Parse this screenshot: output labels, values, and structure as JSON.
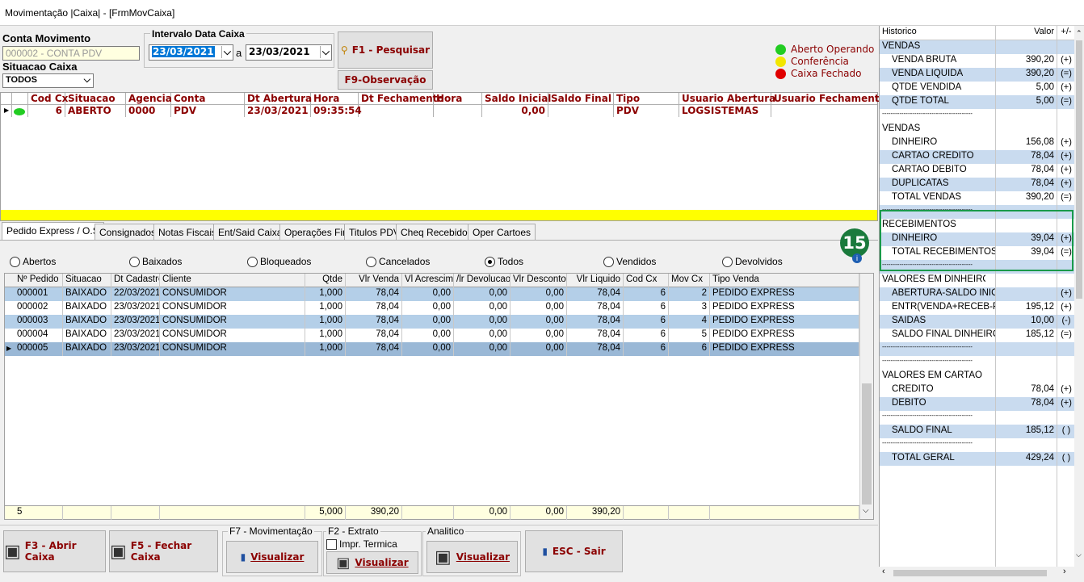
{
  "window": {
    "title": "Movimentação |Caixa| - [FrmMovCaixa]"
  },
  "filters": {
    "conta_label": "Conta Movimento",
    "conta_value": "000002 - CONTA PDV",
    "situacao_label": "Situacao Caixa",
    "situacao_value": "TODOS",
    "intervalo_label": "Intervalo Data Caixa",
    "date_from": "23/03/2021",
    "date_sep": "a",
    "date_to": "23/03/2021",
    "pesquisar": "F1 - Pesquisar",
    "observacao": "F9-Observação"
  },
  "legend": {
    "aberto": "Aberto Operando",
    "conferencia": "Conferência",
    "fechado": "Caixa Fechado",
    "colors": {
      "aberto": "#22cc22",
      "conferencia": "#f2e600",
      "fechado": "#e00000"
    }
  },
  "caixa_grid": {
    "headers": [
      "Cod Cx",
      "Situacao",
      "Agencia",
      "Conta",
      "Dt Abertura",
      "Hora",
      "Dt Fechamento",
      "Hora",
      "Saldo Inicial",
      "Saldo Final",
      "Tipo",
      "Usuario Abertura",
      "Usuario Fechamento"
    ],
    "row": [
      "6",
      "ABERTO",
      "0000",
      "PDV",
      "23/03/2021",
      "09:35:54",
      "",
      "",
      "0,00",
      "",
      "PDV",
      "LOGSISTEMAS",
      ""
    ]
  },
  "tabs": [
    "Pedido Express / O.S",
    "Consignados",
    "Notas Fiscais",
    "Ent/Said Caixa",
    "Operações Fin",
    "Titulos PDV",
    "Cheq Recebidos",
    "Oper Cartoes"
  ],
  "radios": {
    "options": [
      "Abertos",
      "Baixados",
      "Bloqueados",
      "Cancelados",
      "Todos",
      "Vendidos",
      "Devolvidos"
    ],
    "selected": "Todos"
  },
  "badge": "15",
  "pedidos": {
    "headers": [
      "Nº Pedido",
      "Situacao",
      "Dt Cadastro",
      "Cliente",
      "Qtde",
      "Vlr Venda",
      "Vl Acrescim",
      "/lr Devolucao",
      "Vlr Desconto",
      "Vlr Liquido",
      "Cod Cx",
      "Mov Cx",
      "Tipo Venda"
    ],
    "rows": [
      [
        "000001",
        "BAIXADO",
        "22/03/2021",
        "CONSUMIDOR",
        "1,000",
        "78,04",
        "0,00",
        "0,00",
        "0,00",
        "78,04",
        "6",
        "2",
        "PEDIDO EXPRESS"
      ],
      [
        "000002",
        "BAIXADO",
        "23/03/2021",
        "CONSUMIDOR",
        "1,000",
        "78,04",
        "0,00",
        "0,00",
        "0,00",
        "78,04",
        "6",
        "3",
        "PEDIDO EXPRESS"
      ],
      [
        "000003",
        "BAIXADO",
        "23/03/2021",
        "CONSUMIDOR",
        "1,000",
        "78,04",
        "0,00",
        "0,00",
        "0,00",
        "78,04",
        "6",
        "4",
        "PEDIDO EXPRESS"
      ],
      [
        "000004",
        "BAIXADO",
        "23/03/2021",
        "CONSUMIDOR",
        "1,000",
        "78,04",
        "0,00",
        "0,00",
        "0,00",
        "78,04",
        "6",
        "5",
        "PEDIDO EXPRESS"
      ],
      [
        "000005",
        "BAIXADO",
        "23/03/2021",
        "CONSUMIDOR",
        "1,000",
        "78,04",
        "0,00",
        "0,00",
        "0,00",
        "78,04",
        "6",
        "6",
        "PEDIDO EXPRESS"
      ]
    ],
    "footer": [
      "5",
      "",
      "",
      "",
      "5,000",
      "390,20",
      "",
      "0,00",
      "0,00",
      "390,20",
      "",
      "",
      ""
    ]
  },
  "resumo": {
    "headers": [
      "Historico",
      "Valor",
      "+/-"
    ],
    "rows": [
      {
        "h": "VENDAS",
        "v": "",
        "s": "",
        "k": "sec"
      },
      {
        "h": "VENDA BRUTA",
        "v": "390,20",
        "s": "(+)",
        "k": "w"
      },
      {
        "h": "VENDA LIQUIDA",
        "v": "390,20",
        "s": "(=)",
        "k": "b"
      },
      {
        "h": "QTDE VENDIDA",
        "v": "5,00",
        "s": "(+)",
        "k": "w"
      },
      {
        "h": "QTDE TOTAL",
        "v": "5,00",
        "s": "(=)",
        "k": "b"
      },
      {
        "h": "------------------------------------------",
        "v": "",
        "s": "",
        "k": "w"
      },
      {
        "h": "VENDAS",
        "v": "",
        "s": "",
        "k": "sec2"
      },
      {
        "h": "DINHEIRO",
        "v": "156,08",
        "s": "(+)",
        "k": "w"
      },
      {
        "h": "CARTAO CREDITO",
        "v": "78,04",
        "s": "(+)",
        "k": "b"
      },
      {
        "h": "CARTAO DEBITO",
        "v": "78,04",
        "s": "(+)",
        "k": "w"
      },
      {
        "h": "DUPLICATAS",
        "v": "78,04",
        "s": "(+)",
        "k": "b"
      },
      {
        "h": "TOTAL VENDAS",
        "v": "390,20",
        "s": "(=)",
        "k": "w"
      },
      {
        "h": "------------------------------------------",
        "v": "",
        "s": "",
        "k": "b"
      },
      {
        "h": "RECEBIMENTOS",
        "v": "",
        "s": "",
        "k": "sec2"
      },
      {
        "h": "DINHEIRO",
        "v": "39,04",
        "s": "(+)",
        "k": "b"
      },
      {
        "h": "TOTAL RECEBIMENTOS",
        "v": "39,04",
        "s": "(=)",
        "k": "w"
      },
      {
        "h": "------------------------------------------",
        "v": "",
        "s": "",
        "k": "b"
      },
      {
        "h": "VALORES EM DINHEIRO",
        "v": "",
        "s": "",
        "k": "sec2"
      },
      {
        "h": "ABERTURA-SALDO INICIAL",
        "v": "",
        "s": "(+)",
        "k": "b"
      },
      {
        "h": "ENTR(VENDA+RECEB-PGTO)",
        "v": "195,12",
        "s": "(+)",
        "k": "w"
      },
      {
        "h": "SAIDAS",
        "v": "10,00",
        "s": "(-)",
        "k": "b"
      },
      {
        "h": "SALDO FINAL DINHEIRO",
        "v": "185,12",
        "s": "(=)",
        "k": "w"
      },
      {
        "h": "------------------------------------------",
        "v": "",
        "s": "",
        "k": "b"
      },
      {
        "h": "------------------------------------------",
        "v": "",
        "s": "",
        "k": "w"
      },
      {
        "h": "VALORES EM CARTAO",
        "v": "",
        "s": "",
        "k": "sec2"
      },
      {
        "h": "CREDITO",
        "v": "78,04",
        "s": "(+)",
        "k": "w"
      },
      {
        "h": "DEBITO",
        "v": "78,04",
        "s": "(+)",
        "k": "b"
      },
      {
        "h": "------------------------------------------",
        "v": "",
        "s": "",
        "k": "w"
      },
      {
        "h": "SALDO FINAL",
        "v": "185,12",
        "s": "( )",
        "k": "b"
      },
      {
        "h": "------------------------------------------",
        "v": "",
        "s": "",
        "k": "w"
      },
      {
        "h": "TOTAL GERAL",
        "v": "429,24",
        "s": "( )",
        "k": "b"
      }
    ]
  },
  "bottom": {
    "abrir": "F3 - Abrir Caixa",
    "fechar": "F5 - Fechar Caixa",
    "mov_label": "F7 - Movimentação",
    "visualizar": "Visualizar",
    "extrato_label": "F2 - Extrato",
    "impr_termica": "Impr. Termica",
    "analitico_label": "Analitico",
    "sair": "ESC - Sair"
  }
}
